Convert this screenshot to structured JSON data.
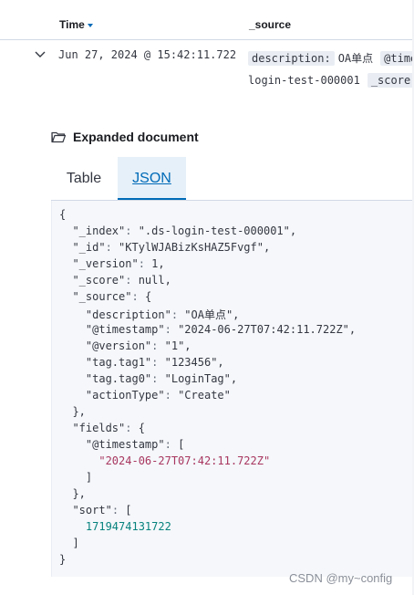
{
  "table": {
    "header": {
      "time_label": "Time",
      "source_label": "_source"
    },
    "row": {
      "time": "Jun 27, 2024 @ 15:42:11.722",
      "source_line1": [
        {
          "key": "description:",
          "value": "OA单点"
        },
        {
          "key": "@time",
          "value": ""
        }
      ],
      "source_line2": [
        {
          "key": "",
          "value": "login-test-000001"
        },
        {
          "key": "_score:",
          "value": ""
        }
      ]
    }
  },
  "expanded": {
    "title": "Expanded document"
  },
  "tabs": {
    "table": "Table",
    "json": "JSON",
    "active": "JSON"
  },
  "json_lines": [
    "{",
    "  \"_index\": \".ds-login-test-000001\",",
    "  \"_id\": \"KTylWJABizKsHAZ5Fvgf\",",
    "  \"_version\": 1,",
    "  \"_score\": null,",
    "  \"_source\": {",
    "    \"description\": \"OA单点\",",
    "    \"@timestamp\": \"2024-06-27T07:42:11.722Z\",",
    "    \"@version\": \"1\",",
    "    \"tag.tag1\": \"123456\",",
    "    \"tag.tag0\": \"LoginTag\",",
    "    \"actionType\": \"Create\"",
    "  },",
    "  \"fields\": {",
    "    \"@timestamp\": [",
    "      \"2024-06-27T07:42:11.722Z\"",
    "    ]",
    "  },",
    "  \"sort\": [",
    "    1719474131722",
    "  ]",
    "}"
  ],
  "watermark": "CSDN @my~config",
  "colors": {
    "accent": "#006bb8",
    "string": "#a8365f",
    "number": "#07827e"
  }
}
